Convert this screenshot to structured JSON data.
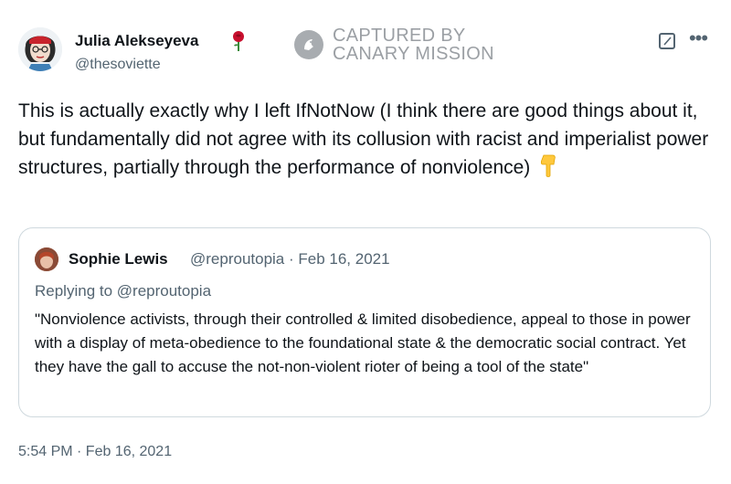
{
  "author": {
    "name": "Julia Alekseyeva",
    "handle": "@thesoviette"
  },
  "watermark": {
    "text": "CAPTURED BY\nCANARY MISSION"
  },
  "tweet": {
    "text": "This is actually exactly why I left IfNotNow (I think there are good things about it, but fundamentally did not agree with its collusion with racist and imperialist power structures, partially through the performance of nonviolence)",
    "emoji": "👇",
    "timestamp": "5:54 PM · Feb 16, 2021"
  },
  "quote": {
    "name": "Sophie Lewis",
    "handle_date": "@reproutopia · Feb 16, 2021",
    "replying_to": "Replying to @reproutopia",
    "text": "\"Nonviolence activists, through their controlled & limited disobedience, appeal to those in power with a display of meta-obedience to the foundational state & the democratic social contract. Yet they have the gall to accuse the not-non-violent rioter of being a tool of the state\""
  },
  "icons": {
    "author_badge": "rose-icon",
    "edit": "edit-icon",
    "more": "more-icon"
  },
  "colors": {
    "text_primary": "#0f1419",
    "text_secondary": "#536471",
    "border": "#cfd9de"
  }
}
